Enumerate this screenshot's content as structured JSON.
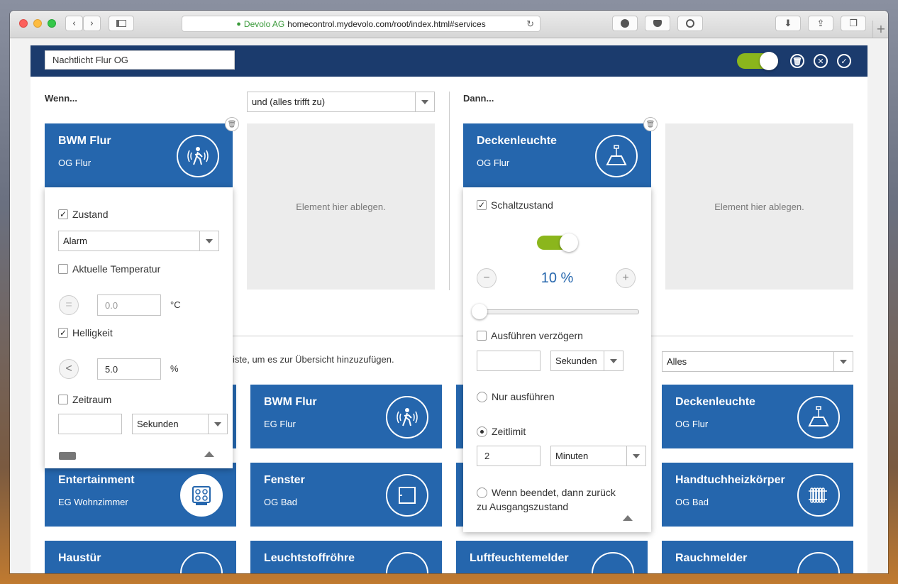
{
  "browser": {
    "site_name": "Devolo AG",
    "url": "homecontrol.mydevolo.com/root/index.html#services"
  },
  "header": {
    "rule_name": "Nachtlicht Flur OG",
    "enabled": true
  },
  "when": {
    "label": "Wenn...",
    "condition_select": "und (alles trifft zu)",
    "trigger_tile": {
      "title": "BWM Flur",
      "subtitle": "OG Flur",
      "icon": "motion-sensor-icon"
    },
    "drop_text": "Element hier ablegen.",
    "panel": {
      "zustand_label": "Zustand",
      "zustand_checked": true,
      "zustand_select": "Alarm",
      "temp_label": "Aktuelle Temperatur",
      "temp_checked": false,
      "temp_operator": "=",
      "temp_placeholder": "0.0",
      "temp_unit": "°C",
      "helligkeit_label": "Helligkeit",
      "helligkeit_checked": true,
      "helligkeit_operator": "<",
      "helligkeit_value": "5.0",
      "helligkeit_unit": "%",
      "zeitraum_label": "Zeitraum",
      "zeitraum_checked": false,
      "zeitraum_value": "",
      "zeitraum_unit": "Sekunden"
    }
  },
  "then": {
    "label": "Dann...",
    "action_tile": {
      "title": "Deckenleuchte",
      "subtitle": "OG Flur",
      "icon": "ceiling-lamp-icon"
    },
    "drop_text": "Element hier ablegen.",
    "panel": {
      "schalt_label": "Schaltzustand",
      "schalt_checked": true,
      "switch_on": true,
      "minus": "−",
      "plus": "+",
      "dim_value": "10 %",
      "dim_level": 0.1,
      "delay_label": "Ausführen verzögern",
      "delay_checked": false,
      "delay_value": "",
      "delay_unit": "Sekunden",
      "nur_label": "Nur ausführen",
      "zeitlimit_label": "Zeitlimit",
      "zeitlimit_value": "2",
      "zeitlimit_unit": "Minuten",
      "return_label_1": "Wenn beendet, dann zurück",
      "return_label_2": "zu Ausgangszustand"
    }
  },
  "overview": {
    "hint": "iste, um es zur Übersicht hinzuzufügen.",
    "filter": "Alles",
    "tiles": [
      {
        "title": "BWM Flur",
        "subtitle": "EG Flur",
        "icon": "motion-sensor-icon"
      },
      {
        "title": "Deckenleuchte",
        "subtitle": "OG Flur",
        "icon": "ceiling-lamp-icon"
      },
      {
        "title": "Entertainment",
        "subtitle": "EG Wohnzimmer",
        "icon": "entertainment-icon"
      },
      {
        "title": "Fenster",
        "subtitle": "OG Bad",
        "icon": "window-icon"
      },
      {
        "title": "Handtuchheizkörper",
        "subtitle": "OG Bad",
        "icon": "radiator-icon"
      },
      {
        "title": "Haustür",
        "subtitle": "",
        "icon": "door-icon"
      },
      {
        "title": "Leuchtstoffröhre",
        "subtitle": "",
        "icon": "bulb-icon"
      },
      {
        "title": "Luftfeuchtemelder",
        "subtitle": "",
        "icon": "humidity-icon"
      },
      {
        "title": "Rauchmelder",
        "subtitle": "",
        "icon": "smoke-icon"
      }
    ]
  },
  "colors": {
    "header": "#1b3b6d",
    "tile": "#2566ad",
    "toggle": "#8bb61c",
    "accent_text": "#2566ad"
  }
}
